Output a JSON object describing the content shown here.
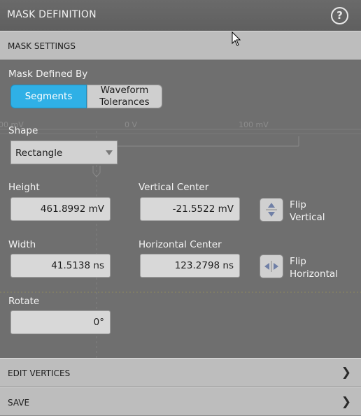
{
  "title": "MASK DEFINITION",
  "help_icon": "help-circle-icon",
  "background_plot": {
    "tick_left": "00 mV",
    "tick_center": "0 V",
    "tick_right": "100 mV"
  },
  "mask_settings": {
    "header": "MASK SETTINGS",
    "defined_by_label": "Mask Defined By",
    "segments_label": "Segments",
    "waveform_label_line1": "Waveform",
    "waveform_label_line2": "Tolerances",
    "selected": "Segments",
    "shape_label": "Shape",
    "shape_value": "Rectangle",
    "height_label": "Height",
    "height_value": "461.8992 mV",
    "vertical_center_label": "Vertical Center",
    "vertical_center_value": "-21.5522 mV",
    "flip_vertical_line1": "Flip",
    "flip_vertical_line2": "Vertical",
    "width_label": "Width",
    "width_value": "41.5138 ns",
    "horizontal_center_label": "Horizontal Center",
    "horizontal_center_value": "123.2798 ns",
    "flip_horizontal_line1": "Flip",
    "flip_horizontal_line2": "Horizontal",
    "rotate_label": "Rotate",
    "rotate_value": "0°"
  },
  "edit_vertices": {
    "header": "EDIT VERTICES"
  },
  "save": {
    "header": "SAVE"
  },
  "colors": {
    "accent": "#2fb0e6",
    "panel": "#6f6f6f",
    "header": "#bdbdbd"
  }
}
